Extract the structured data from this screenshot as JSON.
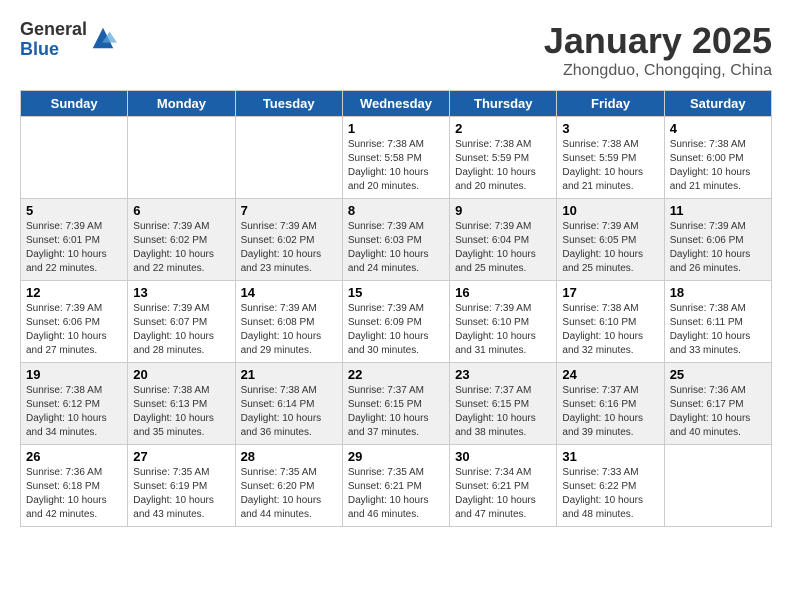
{
  "header": {
    "logo_general": "General",
    "logo_blue": "Blue",
    "title": "January 2025",
    "subtitle": "Zhongduo, Chongqing, China"
  },
  "calendar": {
    "days_of_week": [
      "Sunday",
      "Monday",
      "Tuesday",
      "Wednesday",
      "Thursday",
      "Friday",
      "Saturday"
    ],
    "weeks": [
      [
        {
          "day": "",
          "info": ""
        },
        {
          "day": "",
          "info": ""
        },
        {
          "day": "",
          "info": ""
        },
        {
          "day": "1",
          "info": "Sunrise: 7:38 AM\nSunset: 5:58 PM\nDaylight: 10 hours and 20 minutes."
        },
        {
          "day": "2",
          "info": "Sunrise: 7:38 AM\nSunset: 5:59 PM\nDaylight: 10 hours and 20 minutes."
        },
        {
          "day": "3",
          "info": "Sunrise: 7:38 AM\nSunset: 5:59 PM\nDaylight: 10 hours and 21 minutes."
        },
        {
          "day": "4",
          "info": "Sunrise: 7:38 AM\nSunset: 6:00 PM\nDaylight: 10 hours and 21 minutes."
        }
      ],
      [
        {
          "day": "5",
          "info": "Sunrise: 7:39 AM\nSunset: 6:01 PM\nDaylight: 10 hours and 22 minutes."
        },
        {
          "day": "6",
          "info": "Sunrise: 7:39 AM\nSunset: 6:02 PM\nDaylight: 10 hours and 22 minutes."
        },
        {
          "day": "7",
          "info": "Sunrise: 7:39 AM\nSunset: 6:02 PM\nDaylight: 10 hours and 23 minutes."
        },
        {
          "day": "8",
          "info": "Sunrise: 7:39 AM\nSunset: 6:03 PM\nDaylight: 10 hours and 24 minutes."
        },
        {
          "day": "9",
          "info": "Sunrise: 7:39 AM\nSunset: 6:04 PM\nDaylight: 10 hours and 25 minutes."
        },
        {
          "day": "10",
          "info": "Sunrise: 7:39 AM\nSunset: 6:05 PM\nDaylight: 10 hours and 25 minutes."
        },
        {
          "day": "11",
          "info": "Sunrise: 7:39 AM\nSunset: 6:06 PM\nDaylight: 10 hours and 26 minutes."
        }
      ],
      [
        {
          "day": "12",
          "info": "Sunrise: 7:39 AM\nSunset: 6:06 PM\nDaylight: 10 hours and 27 minutes."
        },
        {
          "day": "13",
          "info": "Sunrise: 7:39 AM\nSunset: 6:07 PM\nDaylight: 10 hours and 28 minutes."
        },
        {
          "day": "14",
          "info": "Sunrise: 7:39 AM\nSunset: 6:08 PM\nDaylight: 10 hours and 29 minutes."
        },
        {
          "day": "15",
          "info": "Sunrise: 7:39 AM\nSunset: 6:09 PM\nDaylight: 10 hours and 30 minutes."
        },
        {
          "day": "16",
          "info": "Sunrise: 7:39 AM\nSunset: 6:10 PM\nDaylight: 10 hours and 31 minutes."
        },
        {
          "day": "17",
          "info": "Sunrise: 7:38 AM\nSunset: 6:10 PM\nDaylight: 10 hours and 32 minutes."
        },
        {
          "day": "18",
          "info": "Sunrise: 7:38 AM\nSunset: 6:11 PM\nDaylight: 10 hours and 33 minutes."
        }
      ],
      [
        {
          "day": "19",
          "info": "Sunrise: 7:38 AM\nSunset: 6:12 PM\nDaylight: 10 hours and 34 minutes."
        },
        {
          "day": "20",
          "info": "Sunrise: 7:38 AM\nSunset: 6:13 PM\nDaylight: 10 hours and 35 minutes."
        },
        {
          "day": "21",
          "info": "Sunrise: 7:38 AM\nSunset: 6:14 PM\nDaylight: 10 hours and 36 minutes."
        },
        {
          "day": "22",
          "info": "Sunrise: 7:37 AM\nSunset: 6:15 PM\nDaylight: 10 hours and 37 minutes."
        },
        {
          "day": "23",
          "info": "Sunrise: 7:37 AM\nSunset: 6:15 PM\nDaylight: 10 hours and 38 minutes."
        },
        {
          "day": "24",
          "info": "Sunrise: 7:37 AM\nSunset: 6:16 PM\nDaylight: 10 hours and 39 minutes."
        },
        {
          "day": "25",
          "info": "Sunrise: 7:36 AM\nSunset: 6:17 PM\nDaylight: 10 hours and 40 minutes."
        }
      ],
      [
        {
          "day": "26",
          "info": "Sunrise: 7:36 AM\nSunset: 6:18 PM\nDaylight: 10 hours and 42 minutes."
        },
        {
          "day": "27",
          "info": "Sunrise: 7:35 AM\nSunset: 6:19 PM\nDaylight: 10 hours and 43 minutes."
        },
        {
          "day": "28",
          "info": "Sunrise: 7:35 AM\nSunset: 6:20 PM\nDaylight: 10 hours and 44 minutes."
        },
        {
          "day": "29",
          "info": "Sunrise: 7:35 AM\nSunset: 6:21 PM\nDaylight: 10 hours and 46 minutes."
        },
        {
          "day": "30",
          "info": "Sunrise: 7:34 AM\nSunset: 6:21 PM\nDaylight: 10 hours and 47 minutes."
        },
        {
          "day": "31",
          "info": "Sunrise: 7:33 AM\nSunset: 6:22 PM\nDaylight: 10 hours and 48 minutes."
        },
        {
          "day": "",
          "info": ""
        }
      ]
    ]
  }
}
